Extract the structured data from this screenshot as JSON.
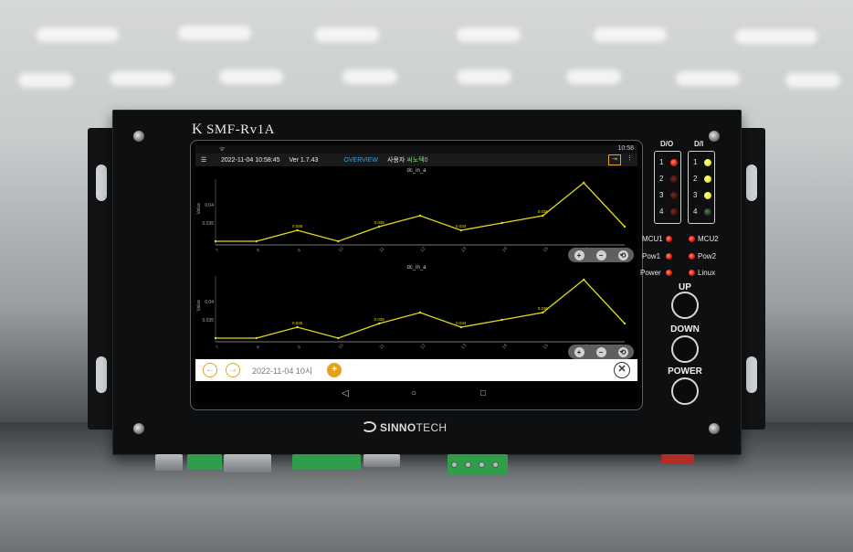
{
  "device": {
    "model_prefix": "K",
    "model": "SMF-Rv1A",
    "brand_main": "SINNO",
    "brand_tail": "TECH"
  },
  "status_bar": {
    "clock": "10:58",
    "wifi": "ᯤ"
  },
  "app_bar": {
    "menu_icon": "☰",
    "datetime": "2022-11-04 10:58:45",
    "version": "Ver 1.7.43",
    "overview_tab": "OVERVIEW",
    "user_label": "사용자",
    "user_name": "씨노텍0",
    "exit_icon": "⇥",
    "more_icon": "⋮"
  },
  "chart_data": [
    {
      "type": "line",
      "title": "dc_in_a",
      "ylabel": "Value",
      "yticks": [
        "0.04",
        "0.035"
      ],
      "x": [
        "7",
        "8",
        "9",
        "10",
        "11",
        "12",
        "13",
        "14",
        "15",
        "16"
      ],
      "values": [
        0.03,
        0.03,
        0.033,
        0.03,
        0.034,
        0.037,
        0.033,
        0.035,
        0.037,
        0.046,
        0.034
      ],
      "point_labels": [
        "",
        "",
        "0.035",
        "",
        "0.035",
        "",
        "0.034",
        "",
        "0.036",
        "",
        ""
      ],
      "color": "#e6d81c",
      "ylim": [
        0.029,
        0.047
      ]
    },
    {
      "type": "line",
      "title": "dc_in_a",
      "ylabel": "Value",
      "yticks": [
        "0.04",
        "0.035"
      ],
      "x": [
        "7",
        "8",
        "9",
        "10",
        "11",
        "12",
        "13",
        "14",
        "15",
        "16"
      ],
      "values": [
        0.03,
        0.03,
        0.033,
        0.03,
        0.034,
        0.037,
        0.033,
        0.035,
        0.037,
        0.046,
        0.034
      ],
      "point_labels": [
        "",
        "",
        "0.035",
        "",
        "0.035",
        "",
        "0.034",
        "",
        "0.036",
        "",
        ""
      ],
      "color": "#e6d81c",
      "ylim": [
        0.029,
        0.047
      ]
    }
  ],
  "zoom_controls": {
    "zoom_in": "+",
    "zoom_out": "−",
    "reset": "⟲"
  },
  "date_bar": {
    "prev_icon": "←",
    "next_icon": "→",
    "date_text": "2022-11-04 10시",
    "add_icon": "+",
    "close_icon": "✕"
  },
  "android_nav": {
    "back": "◁",
    "home": "○",
    "recents": "□"
  },
  "panel": {
    "do_label": "D/O",
    "di_label": "D/I",
    "do_rows": [
      {
        "num": "1",
        "state": "red"
      },
      {
        "num": "2",
        "state": "dim"
      },
      {
        "num": "3",
        "state": "dim"
      },
      {
        "num": "4",
        "state": "dim"
      }
    ],
    "di_rows": [
      {
        "num": "1",
        "state": "yel"
      },
      {
        "num": "2",
        "state": "yel"
      },
      {
        "num": "3",
        "state": "yel"
      },
      {
        "num": "4",
        "state": "grn"
      }
    ],
    "status": {
      "mcu1": "MCU1",
      "mcu2": "MCU2",
      "pow1": "Pow1",
      "pow2": "Pow2",
      "power": "Power",
      "linux": "Linux"
    },
    "buttons": {
      "up": "UP",
      "down": "DOWN",
      "power": "POWER"
    }
  }
}
